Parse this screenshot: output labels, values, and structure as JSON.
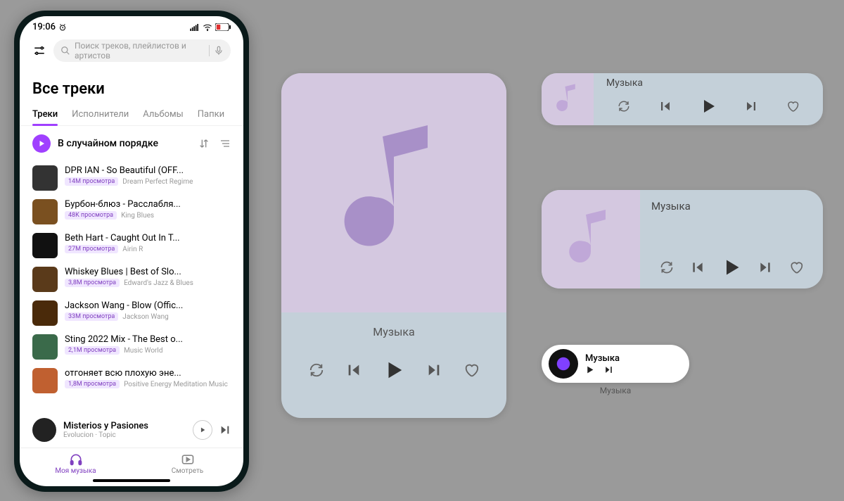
{
  "status": {
    "time": "19:06"
  },
  "search": {
    "placeholder": "Поиск треков, плейлистов и артистов"
  },
  "page_title": "Все треки",
  "tabs": {
    "tracks": "Треки",
    "artists": "Исполнители",
    "albums": "Альбомы",
    "folders": "Папки"
  },
  "shuffle_label": "В случайном порядке",
  "tracks": [
    {
      "title": "DPR IAN - So Beautiful (OFF...",
      "views": "14M просмотра",
      "artist": "Dream Perfect Regime"
    },
    {
      "title": "Бурбон-блюз - Расслабля...",
      "views": "48K просмотра",
      "artist": "King Blues"
    },
    {
      "title": "Beth Hart - Caught Out In T...",
      "views": "27M просмотра",
      "artist": "Airin R"
    },
    {
      "title": "Whiskey Blues | Best of Slo...",
      "views": "3,8M просмотра",
      "artist": "Edward's Jazz & Blues"
    },
    {
      "title": "Jackson Wang - Blow (Offic...",
      "views": "33M просмотра",
      "artist": "Jackson Wang"
    },
    {
      "title": "Sting 2022 Mix - The Best o...",
      "views": "2,1M просмотра",
      "artist": "Music World"
    },
    {
      "title": "отгоняет всю плохую эне...",
      "views": "1,8M просмотра",
      "artist": "Positive Energy Meditation Music"
    }
  ],
  "now_playing": {
    "title": "Misterios y Pasiones",
    "artist": "Evolucion · Topic"
  },
  "bottom_nav": {
    "music": "Моя музыка",
    "watch": "Смотреть"
  },
  "widget": {
    "title": "Музыка",
    "pill_label": "Музыка"
  },
  "colors": {
    "accent": "#a040ff",
    "badge_bg": "#f0e6ff",
    "badge_fg": "#8040c0",
    "widget_bg": "#c4d0d9",
    "widget_art": "#d4c8e0"
  }
}
